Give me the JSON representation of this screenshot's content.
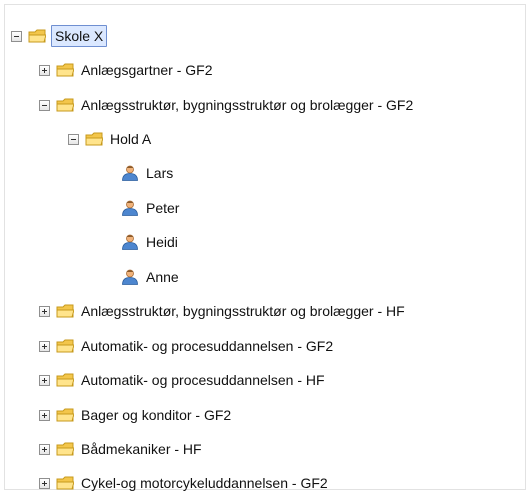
{
  "tree": {
    "root": {
      "label": "Skole X"
    },
    "items": [
      {
        "label": "Anlægsgartner - GF2"
      },
      {
        "label": "Anlægsstruktør, bygningsstruktør og brolægger - GF2"
      },
      {
        "label": "Hold A"
      },
      {
        "label": "Lars"
      },
      {
        "label": "Peter"
      },
      {
        "label": "Heidi"
      },
      {
        "label": "Anne"
      },
      {
        "label": "Anlægsstruktør, bygningsstruktør og brolægger - HF"
      },
      {
        "label": "Automatik- og procesuddannelsen - GF2"
      },
      {
        "label": "Automatik- og procesuddannelsen - HF"
      },
      {
        "label": "Bager og konditor - GF2"
      },
      {
        "label": "Bådmekaniker - HF"
      },
      {
        "label": "Cykel-og motorcykeluddannelsen - GF2"
      }
    ]
  }
}
